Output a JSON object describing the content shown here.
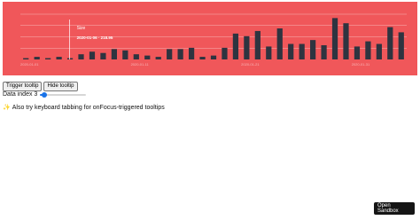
{
  "chart_data": {
    "type": "bar",
    "values": [
      1,
      2,
      1,
      2,
      1,
      4,
      6,
      5,
      8,
      7,
      4,
      3,
      2,
      8,
      8,
      9,
      2,
      3,
      9,
      20,
      18,
      22,
      10,
      24,
      12,
      12,
      15,
      11,
      32,
      28,
      10,
      14,
      12,
      25,
      21
    ],
    "x_tick_labels": [
      "2020-01-01",
      "2020-01-11",
      "2020-01-21",
      "2020-01-31"
    ],
    "ylim": [
      0,
      35
    ],
    "grid": true,
    "tooltip": {
      "series": "Size",
      "date": "2020-01-06",
      "value": "218.95",
      "active_index": 3
    }
  },
  "controls": {
    "trigger_label": "Trigger tooltip",
    "hide_label": "Hide tooltip",
    "slider_label": "Data index 3",
    "slider_value_fraction": 0.09
  },
  "hint": {
    "icon": "sparkles-icon",
    "text": "Also try keyboard tabbing for onFocus-triggered tooltips"
  },
  "sandbox": {
    "line1": "Open",
    "line2": "Sandbox"
  }
}
